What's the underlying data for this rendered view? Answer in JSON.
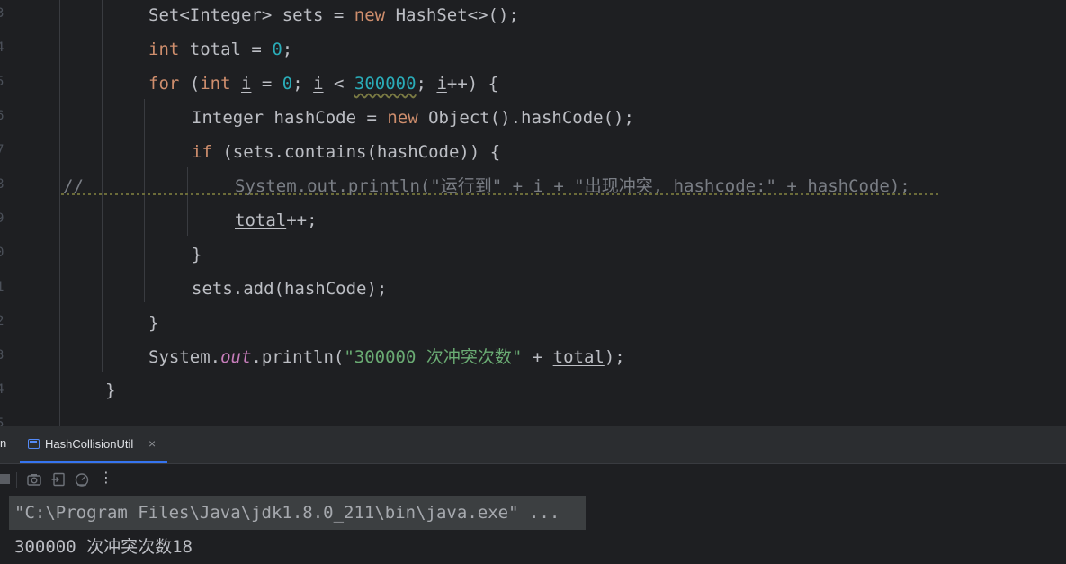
{
  "editor": {
    "line_numbers": [
      "3",
      "4",
      "5",
      "6",
      "7",
      "8",
      "9",
      "0",
      "1",
      "2",
      "3",
      "4",
      "5"
    ],
    "lines": {
      "l1": {
        "type": "Set<Integer>",
        "decl": " sets = ",
        "kw_new": "new",
        "ctor": " HashSet<>();"
      },
      "l2": {
        "kw_int": "int",
        "sp": " ",
        "var": "total",
        "assign": " = ",
        "num": "0",
        "end": ";"
      },
      "l3": {
        "kw_for": "for",
        "open": " (",
        "kw_int": "int",
        "sp": " ",
        "i1": "i",
        "assign": " = ",
        "zero": "0",
        "semi1": "; ",
        "i2": "i",
        "lt": " < ",
        "limit": "300000",
        "semi2": "; ",
        "i3": "i",
        "incr": "++) {"
      },
      "l4": {
        "decl": "Integer hashCode = ",
        "kw_new": "new",
        "rest": " Object().hashCode();"
      },
      "l5": {
        "kw_if": "if",
        "rest": " (sets.contains(hashCode)) {"
      },
      "l6": {
        "marker": "//",
        "comment": "System.out.println(\"运行到\" + i + \"出现冲突, hashcode:\" + hashCode);"
      },
      "l7": {
        "var": "total",
        "rest": "++;"
      },
      "l8": {
        "text": "}"
      },
      "l9": {
        "text": "sets.add(hashCode);"
      },
      "l10": {
        "text": "}"
      },
      "l11": {
        "sys": "System.",
        "out": "out",
        "call": ".println(",
        "str": "\"300000 次冲突次数\"",
        "plus": " + ",
        "var": "total",
        "end": ");"
      },
      "l12": {
        "text": "}"
      }
    }
  },
  "run_panel": {
    "left_tab_stub": "n",
    "tab": {
      "icon": "console-window-icon",
      "label": "HashCollisionUtil",
      "close": "×"
    },
    "toolbar": {
      "icons": [
        "stop-icon",
        "camera-icon",
        "restore-layout-icon",
        "dashboard-icon"
      ],
      "more": "⋮"
    },
    "console": {
      "command": "\"C:\\Program Files\\Java\\jdk1.8.0_211\\bin\\java.exe\" ...",
      "output": "300000 次冲突次数18"
    }
  },
  "colors": {
    "background": "#1e1f22",
    "keyword": "#cf8e6d",
    "number": "#2aacb8",
    "string": "#6aab73",
    "static_field": "#c77dbb",
    "comment": "#7a7e85",
    "text": "#bcbec4",
    "accent": "#3574f0"
  }
}
